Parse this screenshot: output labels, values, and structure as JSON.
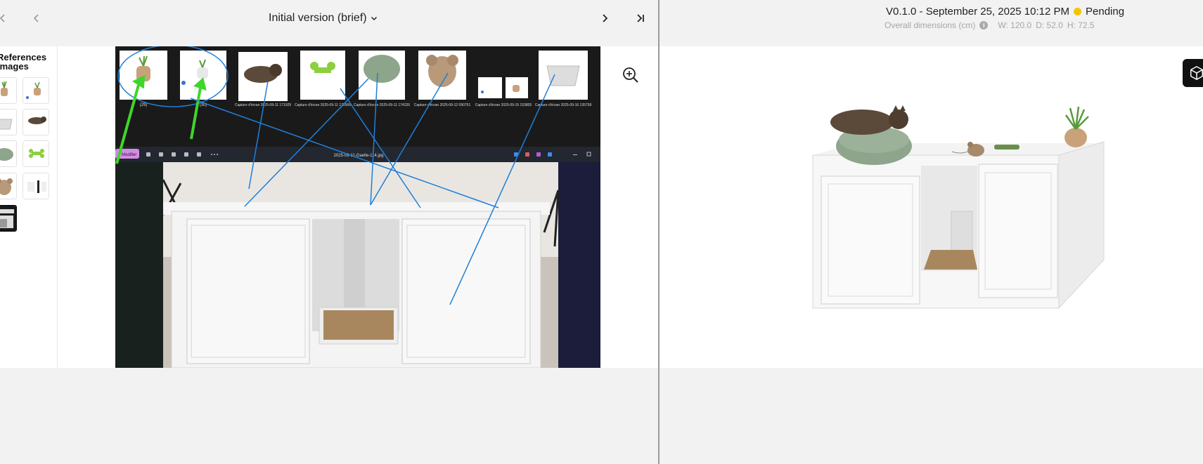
{
  "left_header": {
    "version_label": "Initial version (brief)"
  },
  "references": {
    "title_line1": "References",
    "title_line2": "images"
  },
  "main_image": {
    "file_title": "2025-09-11-Gaelle-114.jpg",
    "edit_label": "Modifier",
    "thumb_captions": [
      "(29)",
      "(30)",
      "Capture d'écran 2025-09-11 171929",
      "Capture d'écran 2025-09-11 173906",
      "Capture d'écran 2025-09-11 174226",
      "Capture d'écran 2025-09-12 090751",
      "Capture d'écran 2025-09-15 153805",
      "Capture d'écran 2025-09-16 135758"
    ]
  },
  "right_header": {
    "version_text": "V0.1.0 - September 25, 2025 10:12 PM",
    "status": "Pending",
    "status_color": "#f5c400",
    "dims_label": "Overall dimensions (cm)",
    "width": "W: 120.0",
    "depth": "D: 52.0",
    "height": "H: 72.5"
  },
  "icons": {
    "first": "chevron-left-icon",
    "prev": "chevron-left-icon",
    "next": "chevron-right-icon",
    "last": "skip-last-icon",
    "zoom": "zoom-in-icon",
    "info": "info-icon",
    "cube": "cube-icon"
  },
  "colors": {
    "annotation_blue": "#1f7fd8",
    "annotation_green": "#3fd62a",
    "pending": "#f5c400"
  }
}
